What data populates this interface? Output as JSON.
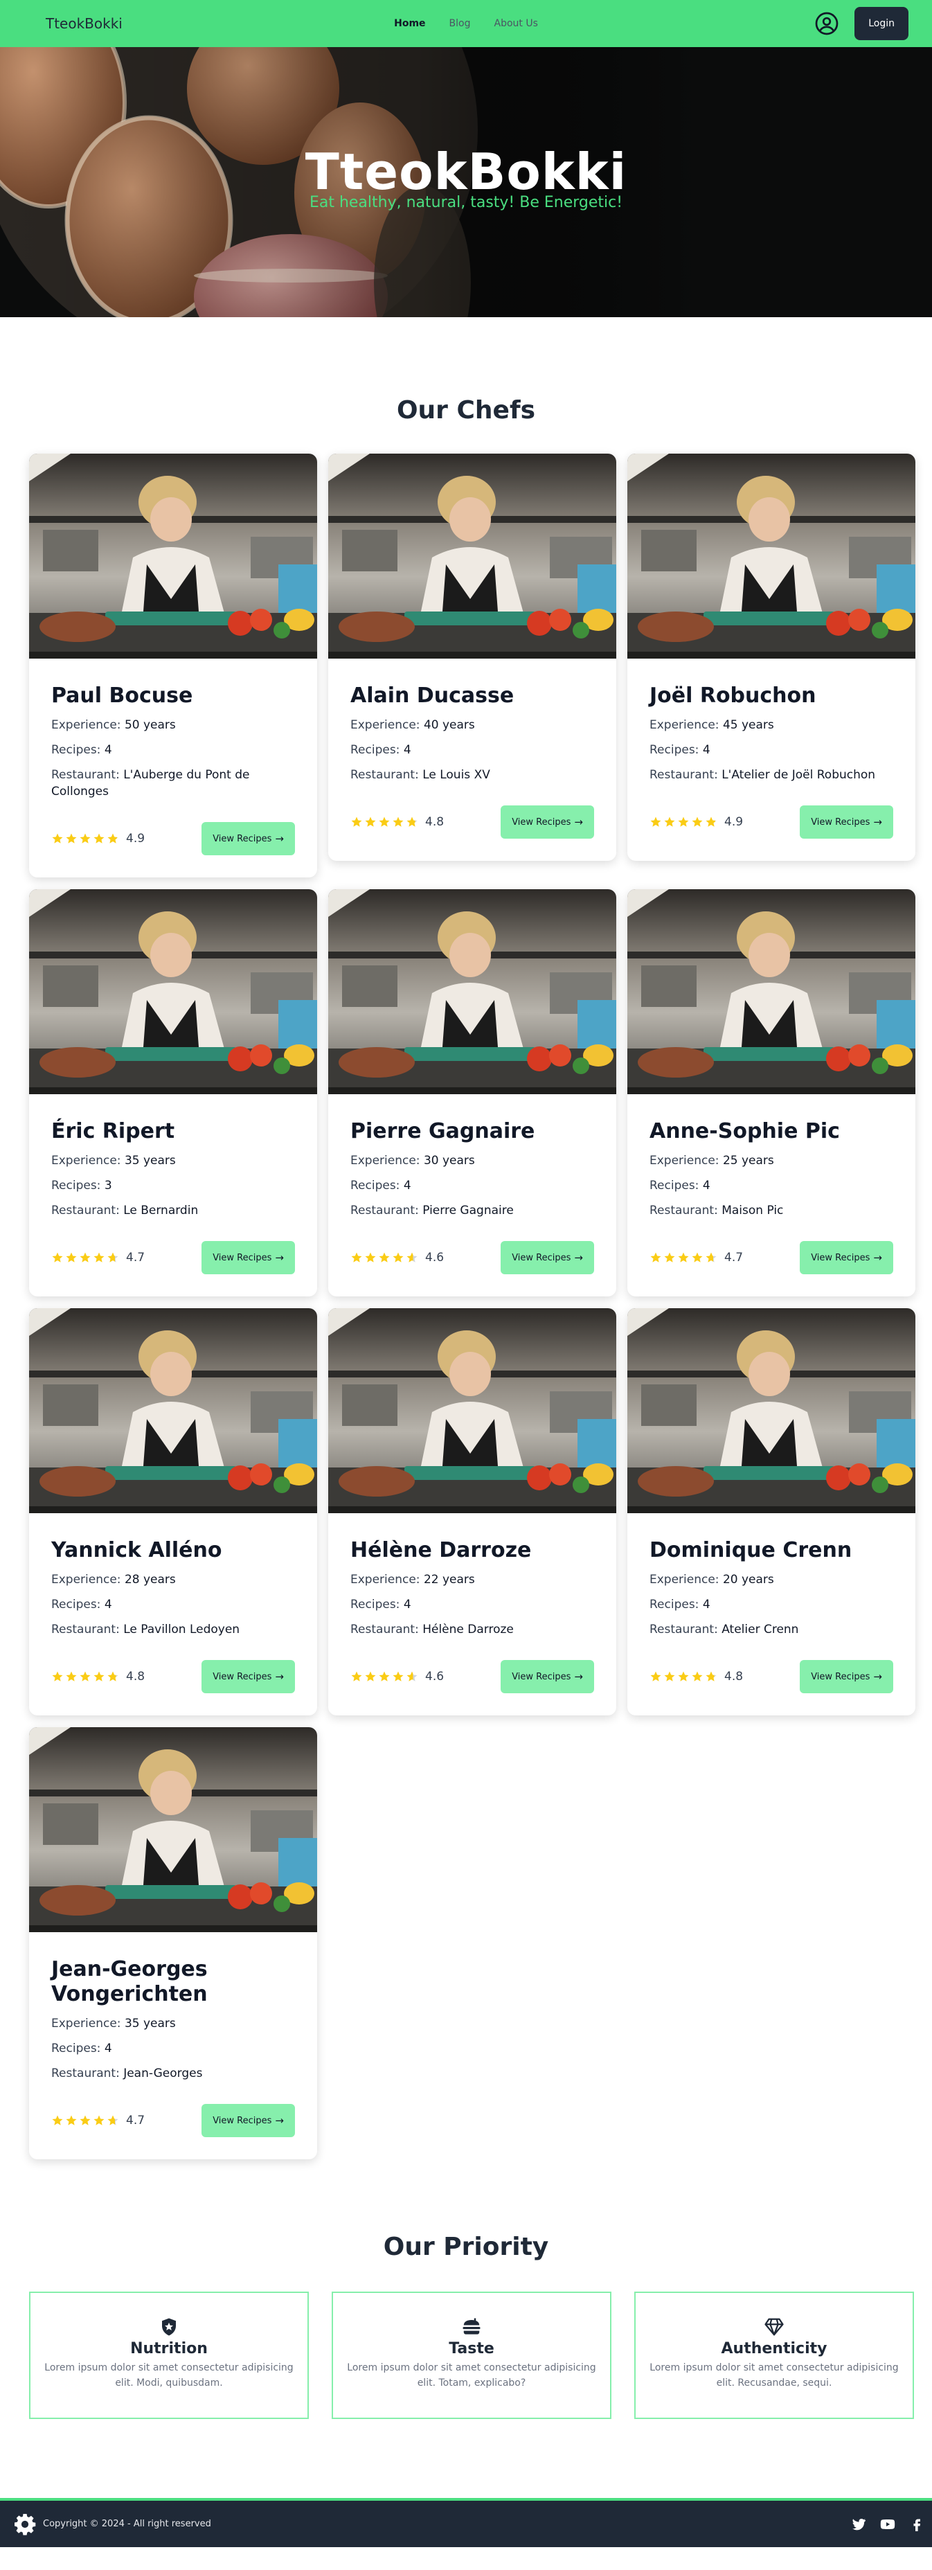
{
  "nav": {
    "brand": "TteokBokki",
    "links": [
      {
        "label": "Home",
        "active": true
      },
      {
        "label": "Blog",
        "active": false
      },
      {
        "label": "About Us",
        "active": false
      }
    ],
    "user_icon": "user-circle-icon",
    "login_label": "Login"
  },
  "hero": {
    "title": "TteokBokki",
    "tagline": "Eat healthy, natural, tasty! Be Energetic!"
  },
  "chefs_section": {
    "title": "Our Chefs",
    "labels": {
      "experience": "Experience:",
      "recipes": "Recipes:",
      "restaurant": "Restaurant:"
    },
    "button_label": "View Recipes",
    "chefs": [
      {
        "name": "Paul Bocuse",
        "experience": "50 years",
        "recipes": "4",
        "restaurant": "L'Auberge du Pont de Collonges",
        "rating": "4.9"
      },
      {
        "name": "Alain Ducasse",
        "experience": "40 years",
        "recipes": "4",
        "restaurant": "Le Louis XV",
        "rating": "4.8"
      },
      {
        "name": "Joël Robuchon",
        "experience": "45 years",
        "recipes": "4",
        "restaurant": "L'Atelier de Joël Robuchon",
        "rating": "4.9"
      },
      {
        "name": "Éric Ripert",
        "experience": "35 years",
        "recipes": "3",
        "restaurant": "Le Bernardin",
        "rating": "4.7"
      },
      {
        "name": "Pierre Gagnaire",
        "experience": "30 years",
        "recipes": "4",
        "restaurant": "Pierre Gagnaire",
        "rating": "4.6"
      },
      {
        "name": "Anne-Sophie Pic",
        "experience": "25 years",
        "recipes": "4",
        "restaurant": "Maison Pic",
        "rating": "4.7"
      },
      {
        "name": "Yannick Alléno",
        "experience": "28 years",
        "recipes": "4",
        "restaurant": "Le Pavillon Ledoyen",
        "rating": "4.8"
      },
      {
        "name": "Hélène Darroze",
        "experience": "22 years",
        "recipes": "4",
        "restaurant": "Hélène Darroze",
        "rating": "4.6"
      },
      {
        "name": "Dominique Crenn",
        "experience": "20 years",
        "recipes": "4",
        "restaurant": "Atelier Crenn",
        "rating": "4.8"
      },
      {
        "name": "Jean-Georges Vongerichten",
        "experience": "35 years",
        "recipes": "4",
        "restaurant": "Jean-Georges",
        "rating": "4.7"
      }
    ]
  },
  "priority_section": {
    "title": "Our Priority",
    "items": [
      {
        "icon": "shield-icon",
        "title": "Nutrition",
        "text": "Lorem ipsum dolor sit amet consectetur adipisicing elit. Modi, quibusdam."
      },
      {
        "icon": "burger-icon",
        "title": "Taste",
        "text": "Lorem ipsum dolor sit amet consectetur adipisicing elit. Totam, explicabo?"
      },
      {
        "icon": "diamond-icon",
        "title": "Authenticity",
        "text": "Lorem ipsum dolor sit amet consectetur adipisicing elit. Recusandae, sequi."
      }
    ]
  },
  "footer": {
    "logo_icon": "gear-icon",
    "copyright": "Copyright © 2024 - All right reserved",
    "social_icons": [
      "twitter-icon",
      "youtube-icon",
      "facebook-icon"
    ]
  },
  "colors": {
    "brand_green": "#4ade80",
    "button_green": "#86efac",
    "dark": "#1f2937",
    "star": "#facc15"
  }
}
